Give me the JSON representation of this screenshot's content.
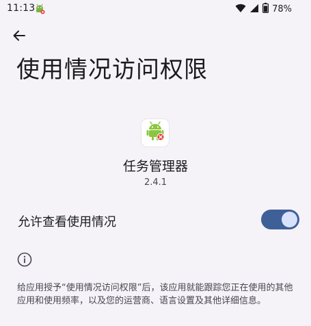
{
  "status_bar": {
    "time": "11:13",
    "battery_percent": "78%",
    "icons": [
      "android-notification-icon",
      "wifi-icon",
      "cellular-signal-icon",
      "battery-icon"
    ]
  },
  "header": {
    "title": "使用情况访问权限"
  },
  "app": {
    "name": "任务管理器",
    "version": "2.4.1",
    "icon": "android-robot-icon"
  },
  "permission": {
    "toggle_label": "允许查看使用情况",
    "enabled": true
  },
  "info": {
    "icon": "info-icon",
    "description": "给应用授予“使用情况访问权限”后，该应用就能跟踪您正在使用的其他应用和使用频率，以及您的运营商、语言设置及其他详细信息。"
  },
  "colors": {
    "background": "#f5f3f7",
    "switch_track": "#3f5f98",
    "switch_thumb": "#d8e2ff",
    "android_green": "#8cc63f",
    "badge_red": "#e53935"
  }
}
